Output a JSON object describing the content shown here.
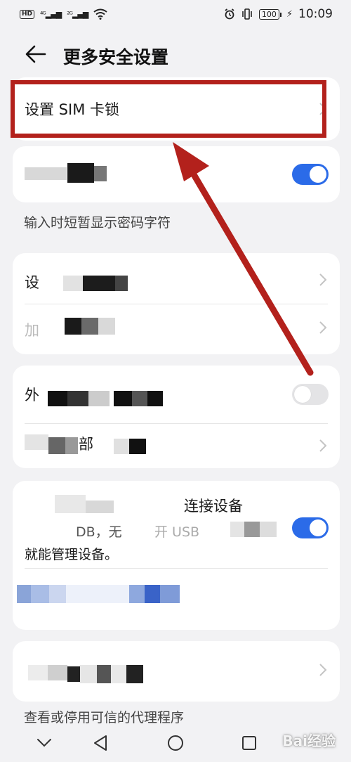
{
  "status_bar": {
    "left": {
      "hd": "HD",
      "sig1": "⁴ᴳ.ıl",
      "sig2": "²ᴳ.ıl",
      "wifi": "wifi"
    },
    "battery": "100",
    "time": "10:09"
  },
  "header": {
    "title": "更多安全设置"
  },
  "sim_lock": {
    "label": "设置 SIM 卡锁"
  },
  "password_card": {
    "label": "",
    "subtitle": "输入时短暂显示密码字符",
    "toggle_on": true
  },
  "card_two": {
    "row1_label": "设",
    "row2_label": "加"
  },
  "card_three": {
    "row1_label": "外",
    "row1_toggle_on": false,
    "row2_label": "部"
  },
  "card_four": {
    "row1_label": "连接设备",
    "row1_text2": "DB，无",
    "row1_text3": "开 USB",
    "row1_subtitle": "就能管理设备。",
    "row1_toggle_on": true
  },
  "card_five": {
    "subtitle": "查看或停用可信的代理程序"
  },
  "watermark": "Bai经验",
  "colors": {
    "accent": "#2b6be8",
    "highlight": "#b3211c",
    "background": "#f2f2f4"
  }
}
